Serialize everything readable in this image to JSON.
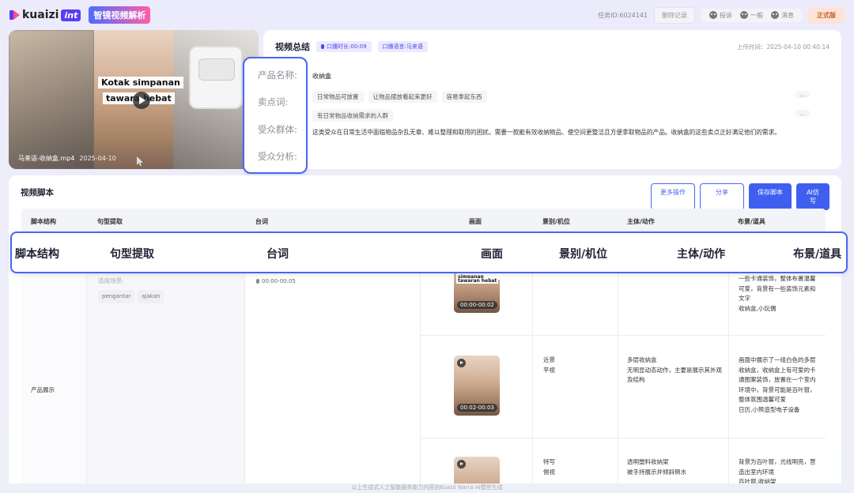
{
  "header": {
    "logo_text": "kuaizi",
    "logo_suffix": "int",
    "app_badge": "智镜视频解析",
    "task_id": "任务ID:6024141",
    "delete_record": "删除记录",
    "feedback": "投诉",
    "rating": "一般",
    "message": "消息",
    "plan": "正式版"
  },
  "video": {
    "caption1": "Kotak simpanan",
    "caption2": "tawara   hebat",
    "filename": "马来语-收纳盒.mp4",
    "date": "2025-04-10"
  },
  "summary": {
    "title": "视频总结",
    "duration_chip": "口播时长:00:09",
    "language_chip": "口播语言:马来语",
    "upload_time": "上传时间：2025-04-10 00:40:14",
    "product_name": "收纳盒",
    "selling_points": [
      "日常物品可放置",
      "让物品摆放看起来更好",
      "容易拿起东西"
    ],
    "audience": [
      "有日常物品收纳需求的人群"
    ],
    "more": "...",
    "analysis": "这类受众在日常生活中面临物品杂乱无章、难以整理和取用的困扰。需要一款能有效收纳物品、使空间更整洁且方便拿取物品的产品。收纳盒的这些卖点正好满足他们的需求。"
  },
  "label_popup": {
    "product_name": "产品名称:",
    "selling_points": "卖点词:",
    "audience": "受众群体:",
    "analysis": "受众分析:"
  },
  "script": {
    "title": "视频脚本",
    "buttons": {
      "more_ops": "更多操作",
      "share": "分享",
      "save": "保存脚本",
      "ai_imitate": "AI仿写"
    },
    "columns": [
      "脚本结构",
      "句型提取",
      "台词",
      "画面",
      "景别/机位",
      "主体/动作",
      "布景/道具"
    ],
    "rows": [
      {
        "structure": "",
        "pattern_label": "适用场景:",
        "pattern_tags": [
          "pengantar",
          "ajakan"
        ],
        "line_time": "00:00-00:05",
        "thumb_time": "00:00-00:02",
        "thumb_cap1": "Kotak simpanan",
        "thumb_cap2": "tawaran hebat",
        "shot": "",
        "subject": "",
        "props": "一些卡通装饰，整体布置温馨可爱，背景有一些装饰元素和文字\n收纳盒,小玩偶"
      },
      {
        "structure": "产品展示",
        "thumb_time": "00:02-00:03",
        "shot": "近景\n平视",
        "subject": "多层收纳盒\n无明显动态动作，主要是展示其外观及结构",
        "props": "画面中展示了一组白色的多层收纳盒，收纳盒上有可爱的卡通图案装饰，放置在一个室内环境中，背景可能是百叶窗，整体氛围温馨可爱\n日历,小熊造型电子设备"
      },
      {
        "structure": "",
        "thumb_time": "",
        "shot": "特写\n侧视",
        "subject": "透明塑料收纳架\n被手持展示并倾斜倒水",
        "props": "背景为百叶窗，光线明亮，营造出室内环境\n百叶窗,收纳架"
      }
    ]
  },
  "footer": "以上生成式人工智能服务能力内容由Kuaizi Narra AI模型生成"
}
